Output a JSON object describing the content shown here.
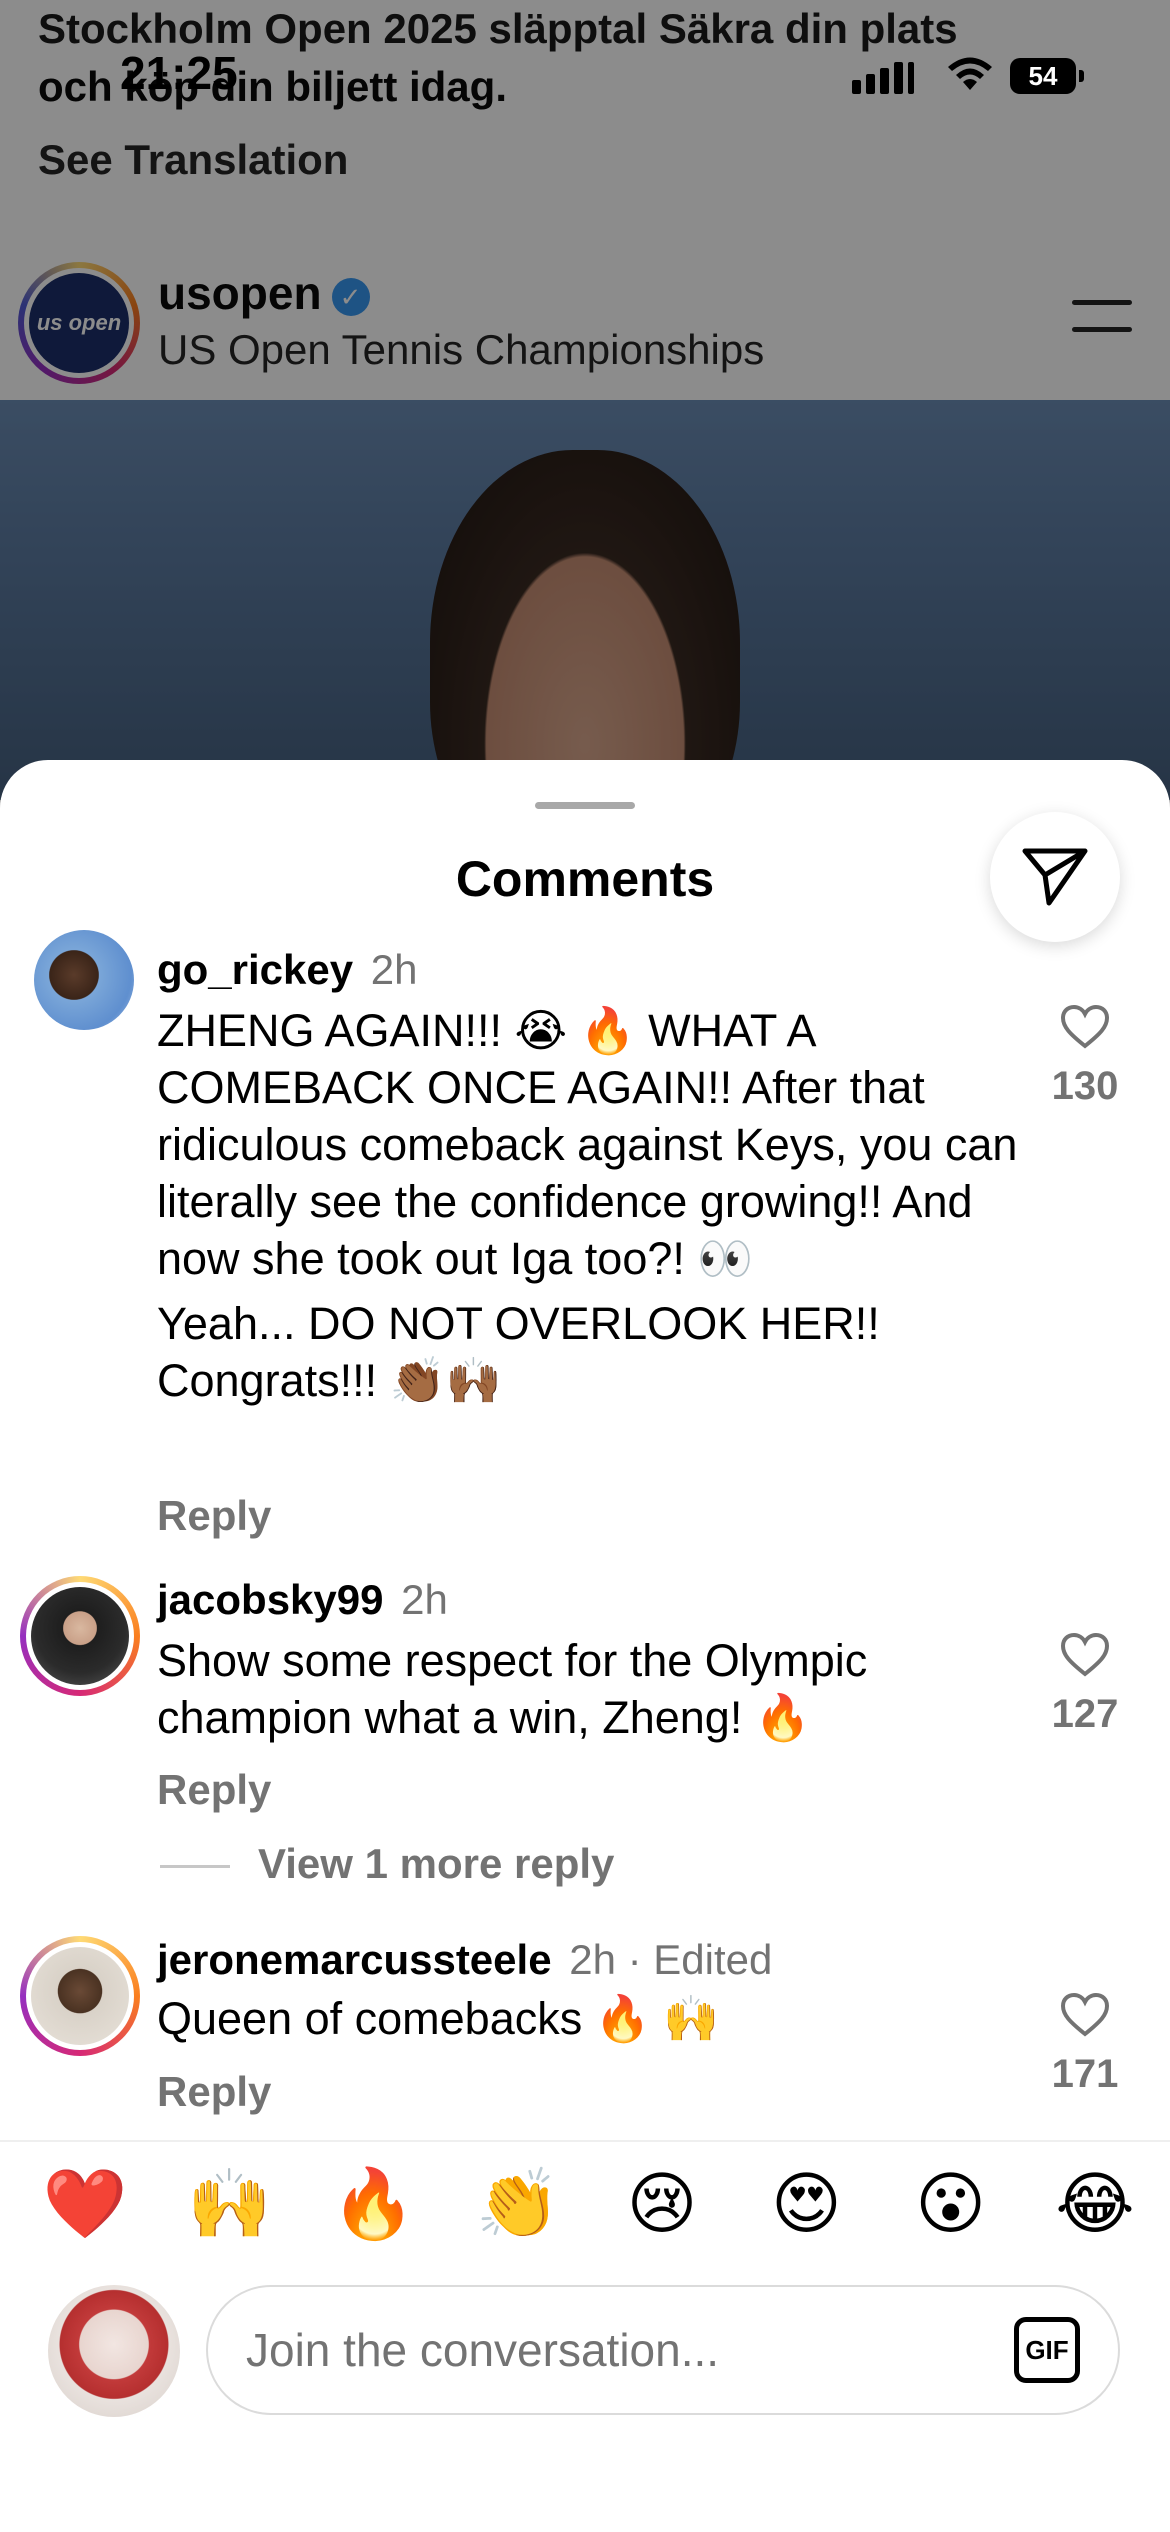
{
  "status_bar": {
    "time": "21:25",
    "battery": "54"
  },
  "background_post": {
    "caption_line1": "Stockholm Open 2025 släpptal Säkra din plats",
    "caption_line2": "och köp din biljett idag.",
    "see_translation": "See Translation",
    "username": "usopen",
    "full_name": "US Open Tennis Championships",
    "avatar_text": "us open"
  },
  "sheet": {
    "title": "Comments"
  },
  "comments": [
    {
      "user": "go_rickey",
      "time": "2h",
      "text1": "ZHENG AGAIN!!! 😭 🔥  WHAT A COMEBACK ONCE AGAIN!! After that ridiculous comeback against Keys, you can literally see the confidence growing!! And now she took out Iga too?! 👀",
      "text2": "Yeah... DO NOT OVERLOOK HER!! Congrats!!! 👏🏾🙌🏾",
      "reply": "Reply",
      "likes": "130"
    },
    {
      "user": "jacobsky99",
      "time": "2h",
      "text1": "Show some respect for the Olympic champion what a win, Zheng! 🔥",
      "reply": "Reply",
      "likes": "127",
      "view_more": "View 1 more reply"
    },
    {
      "user": "jeronemarcussteele",
      "time": "2h · Edited",
      "text1": "Queen of comebacks 🔥 🙌",
      "reply": "Reply",
      "likes": "171"
    }
  ],
  "reactions": [
    "❤️",
    "🙌",
    "🔥",
    "👏",
    "😢",
    "😍",
    "😮",
    "😂"
  ],
  "composer": {
    "placeholder": "Join the conversation...",
    "gif_label": "GIF"
  }
}
